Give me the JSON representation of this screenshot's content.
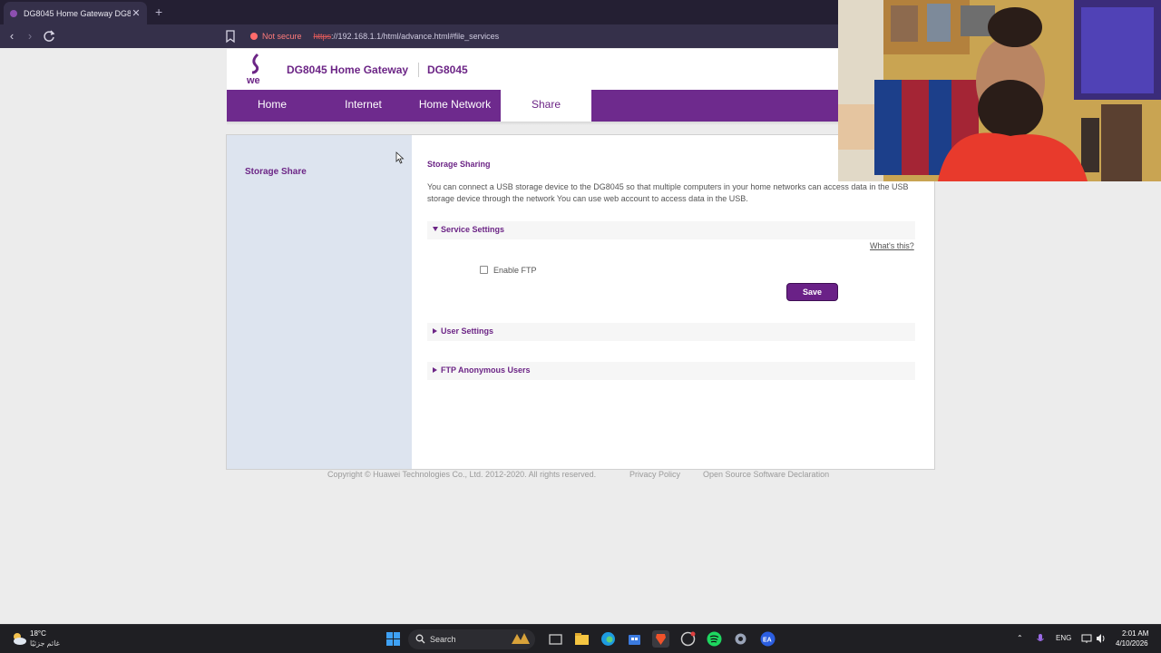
{
  "browser": {
    "tab_title": "DG8045 Home Gateway DG8045",
    "not_secure_label": "Not secure",
    "url_scheme": "https",
    "url_rest": "://192.168.1.1/html/advance.html#file_services"
  },
  "header": {
    "brand": "DG8045 Home Gateway",
    "model": "DG8045"
  },
  "menu": {
    "items": [
      "Home",
      "Internet",
      "Home Network",
      "Share"
    ],
    "active": "Share"
  },
  "sidebar": {
    "items": [
      "Storage Share"
    ]
  },
  "content": {
    "title": "Storage Sharing",
    "description": "You can connect a USB storage device to the DG8045 so that multiple computers in your home networks can access data in the USB storage device through the network You can use web account to access data in the USB.",
    "sections": [
      {
        "label": "Service Settings",
        "expanded": true
      },
      {
        "label": "User Settings",
        "expanded": false
      },
      {
        "label": "FTP Anonymous Users",
        "expanded": false
      }
    ],
    "whats_this": "What's this?",
    "enable_ftp_label": "Enable FTP",
    "enable_ftp_checked": false,
    "save_label": "Save"
  },
  "footer": {
    "copyright": "Copyright © Huawei Technologies Co., Ltd. 2012-2020. All rights reserved.",
    "privacy": "Privacy Policy",
    "open_source": "Open Source Software Declaration"
  },
  "taskbar": {
    "temperature": "18°C",
    "weather_text": "غائم جزئيًا",
    "search_label": "Search",
    "language": "ENG",
    "time": "2:01 AM",
    "date": "4/10/2026"
  },
  "colors": {
    "brand_purple": "#6e2a8d",
    "sidebar_bg": "#dde4ef"
  }
}
